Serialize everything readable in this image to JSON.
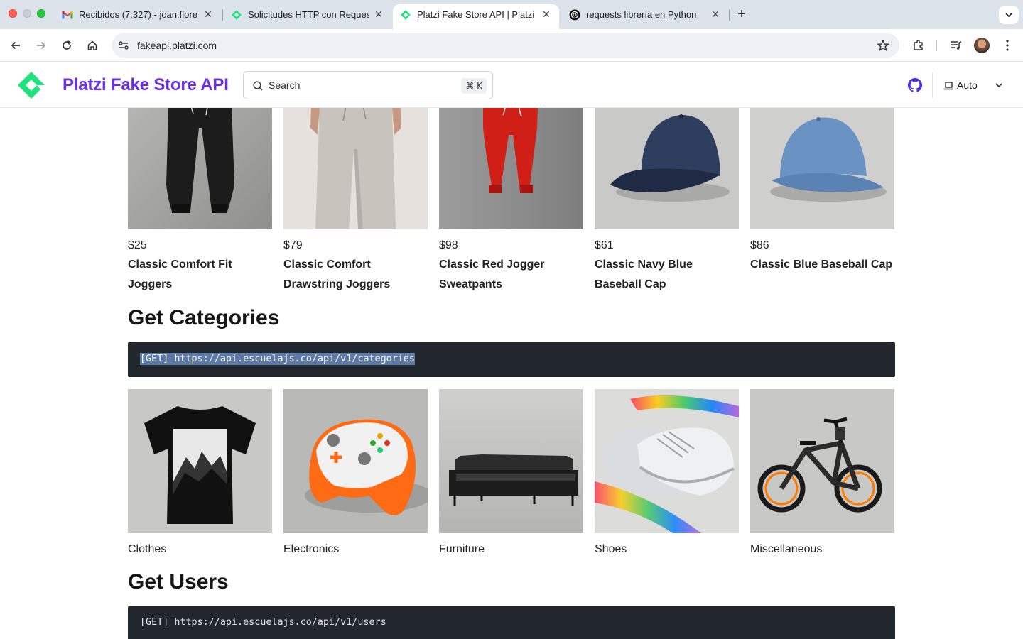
{
  "browser": {
    "tabs": [
      {
        "title": "Recibidos (7.327) - joan.flore",
        "favicon": "gmail-icon"
      },
      {
        "title": "Solicitudes HTTP con Reques",
        "favicon": "platzi-icon"
      },
      {
        "title": "Platzi Fake Store API | Platzi F",
        "favicon": "platzi-icon",
        "active": true
      },
      {
        "title": "requests librería en Python",
        "favicon": "openai-icon"
      }
    ],
    "url": "fakeapi.platzi.com"
  },
  "header": {
    "brand": "Platzi Fake Store API",
    "search_placeholder": "Search",
    "search_shortcut": "⌘ K",
    "theme_label": "Auto"
  },
  "products": [
    {
      "price": "$25",
      "name": "Classic Comfort Fit Joggers",
      "image": "black-joggers"
    },
    {
      "price": "$79",
      "name": "Classic Comfort Drawstring Joggers",
      "image": "beige-joggers"
    },
    {
      "price": "$98",
      "name": "Classic Red Jogger Sweatpants",
      "image": "red-joggers"
    },
    {
      "price": "$61",
      "name": "Classic Navy Blue Baseball Cap",
      "image": "navy-cap"
    },
    {
      "price": "$86",
      "name": "Classic Blue Baseball Cap",
      "image": "blue-cap"
    }
  ],
  "sections": {
    "categories": {
      "heading": "Get Categories",
      "endpoint": "[GET] https://api.escuelajs.co/api/v1/categories"
    },
    "users": {
      "heading": "Get Users",
      "endpoint": "[GET] https://api.escuelajs.co/api/v1/users"
    }
  },
  "categories": [
    {
      "name": "Clothes",
      "image": "tshirt"
    },
    {
      "name": "Electronics",
      "image": "game-controller"
    },
    {
      "name": "Furniture",
      "image": "sofa"
    },
    {
      "name": "Shoes",
      "image": "sneakers"
    },
    {
      "name": "Miscellaneous",
      "image": "bicycle"
    }
  ],
  "colors": {
    "brand": "#6b2ee6",
    "logo": "#1ee27b",
    "code_bg": "#22272e",
    "selection": "#5d79a6"
  }
}
